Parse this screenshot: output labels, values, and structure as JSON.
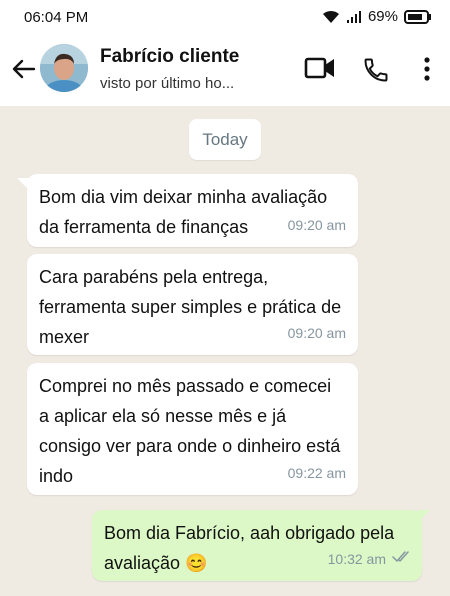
{
  "status_bar": {
    "time": "06:04 PM",
    "battery": "69%",
    "icons": [
      "wifi-icon",
      "signal-icon",
      "battery-icon"
    ]
  },
  "header": {
    "contact_name": "Fabrício cliente",
    "contact_status": "visto por último ho...",
    "icons": [
      "back-arrow-icon",
      "video-call-icon",
      "phone-icon",
      "more-options-icon"
    ]
  },
  "chat": {
    "date_label": "Today",
    "messages": [
      {
        "direction": "incoming",
        "text": " Bom dia vim deixar minha avaliação da ferramenta de finanças",
        "time": "09:20 am"
      },
      {
        "direction": "incoming",
        "text": " Cara parabéns pela entrega, ferramenta super simples e prática de mexer",
        "time": "09:20 am"
      },
      {
        "direction": "incoming",
        "text": " Comprei no mês passado e comecei a aplicar ela só nesse mês e já consigo ver para onde o dinheiro está indo",
        "time": "09:22 am"
      },
      {
        "direction": "outgoing",
        "text": "Bom dia Fabrício, aah obrigado pela avaliação 😊",
        "time": "10:32 am",
        "status": "read"
      }
    ]
  },
  "colors": {
    "chat_background": "#efeae2",
    "incoming_bubble": "#ffffff",
    "outgoing_bubble": "#dcf8c6",
    "timestamp": "#8696a0",
    "read_ticks": "#8696a0"
  }
}
